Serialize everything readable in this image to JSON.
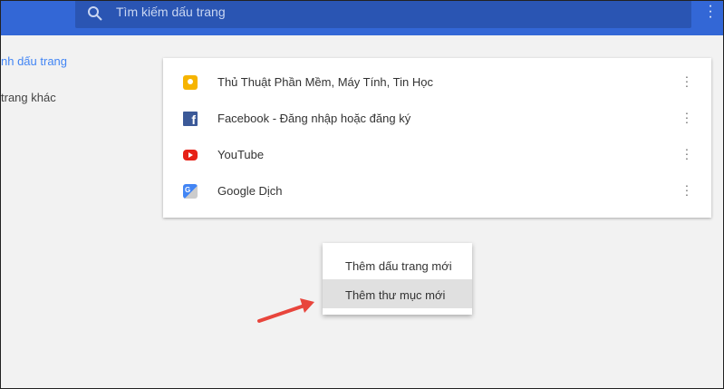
{
  "search": {
    "placeholder": "Tìm kiếm dấu trang"
  },
  "sidebar": {
    "items": [
      {
        "label": "nh dấu trang",
        "color": "#4285f4"
      },
      {
        "label": "trang khác"
      }
    ]
  },
  "bookmarks": [
    {
      "title": "Thủ Thuật Phần Mềm, Máy Tính, Tin Học",
      "icon": "bulb-icon"
    },
    {
      "title": "Facebook - Đăng nhập hoặc đăng ký",
      "icon": "facebook-icon"
    },
    {
      "title": "YouTube",
      "icon": "youtube-icon"
    },
    {
      "title": "Google Dịch",
      "icon": "google-translate-icon"
    }
  ],
  "context_menu": {
    "items": [
      "Thêm dấu trang mới",
      "Thêm thư mục mới"
    ],
    "highlighted": 1
  },
  "colors": {
    "topbar": "#3367d6",
    "arrow": "#e8453c"
  }
}
